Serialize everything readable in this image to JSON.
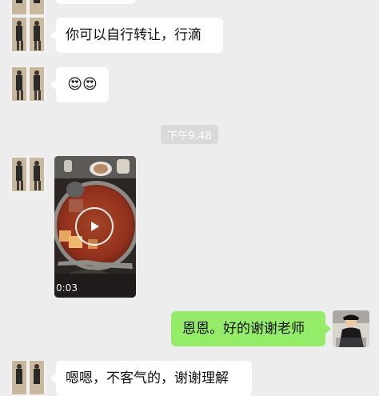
{
  "messages": {
    "m1": {
      "text": "你可以自行转让，行滴"
    },
    "m2": {
      "text": "😍😍"
    },
    "time": "下午9:48",
    "video": {
      "duration": "0:03"
    },
    "m4": {
      "text": "恩恩。好的谢谢老师"
    },
    "m5": {
      "text": "嗯嗯，不客气的，谢谢理解"
    }
  },
  "icons": {
    "play": "play-icon"
  },
  "colors": {
    "background": "#ededed",
    "incoming_bubble": "#ffffff",
    "outgoing_bubble": "#95ec69"
  }
}
